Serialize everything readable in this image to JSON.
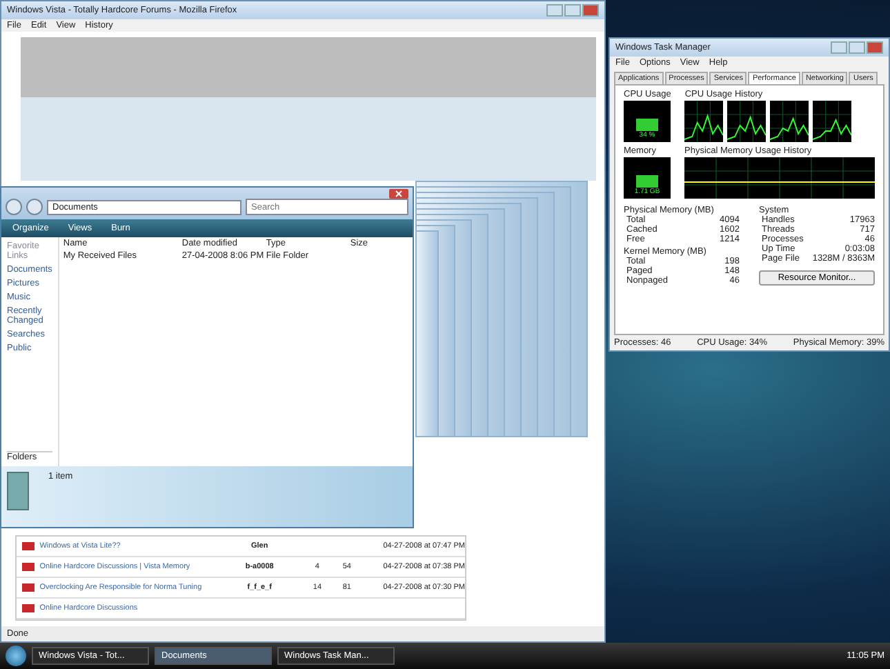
{
  "browser": {
    "title": "Windows Vista - Totally Hardcore Forums - Mozilla Firefox",
    "menu": [
      "File",
      "Edit",
      "View",
      "History"
    ],
    "status": "Done",
    "rows": [
      {
        "title": "Windows at Vista Lite??",
        "user": "Glen",
        "replies": "",
        "views": "",
        "last": "04-27-2008 at 07:47 PM"
      },
      {
        "title": "Online Hardcore Discussions | Vista Memory",
        "user": "b-a0008",
        "replies": "4",
        "views": "54",
        "last": "04-27-2008 at 07:38 PM"
      },
      {
        "title": "Overclocking Are Responsible for Norma Tuning",
        "user": "f_f_e_f",
        "replies": "14",
        "views": "81",
        "last": "04-27-2008 at 07:30 PM"
      },
      {
        "title": "Online Hardcore Discussions",
        "user": "",
        "replies": "",
        "views": "",
        "last": ""
      }
    ]
  },
  "task_manager": {
    "title": "Windows Task Manager",
    "menu": [
      "File",
      "Options",
      "View",
      "Help"
    ],
    "tabs": [
      {
        "label": "Applications",
        "selected": false
      },
      {
        "label": "Processes",
        "selected": false
      },
      {
        "label": "Services",
        "selected": false
      },
      {
        "label": "Performance",
        "selected": true
      },
      {
        "label": "Networking",
        "selected": false
      },
      {
        "label": "Users",
        "selected": false
      }
    ],
    "cpu_label": "CPU Usage",
    "cpu_value": "34 %",
    "cpu_history_label": "CPU Usage History",
    "memory_label": "Memory",
    "memory_value": "1.71 GB",
    "memory_history_label": "Physical Memory Usage History",
    "physical": {
      "heading": "Physical Memory (MB)",
      "rows": [
        {
          "label": "Total",
          "value": "4094"
        },
        {
          "label": "Cached",
          "value": "1602"
        },
        {
          "label": "Free",
          "value": "1214"
        }
      ]
    },
    "kernel": {
      "heading": "Kernel Memory (MB)",
      "rows": [
        {
          "label": "Total",
          "value": "198"
        },
        {
          "label": "Paged",
          "value": "148"
        },
        {
          "label": "Nonpaged",
          "value": "46"
        }
      ]
    },
    "system": {
      "heading": "System",
      "rows": [
        {
          "label": "Handles",
          "value": "17963"
        },
        {
          "label": "Threads",
          "value": "717"
        },
        {
          "label": "Processes",
          "value": "46"
        },
        {
          "label": "Up Time",
          "value": "0:03:08"
        },
        {
          "label": "Page File",
          "value": "1328M / 8363M"
        }
      ]
    },
    "button": "Resource Monitor...",
    "status": [
      "Processes: 46",
      "CPU Usage: 34%",
      "Physical Memory: 39%"
    ]
  },
  "explorer": {
    "path": "Documents",
    "search": {
      "placeholder": "Search"
    },
    "toolbar": [
      "Organize",
      "Views",
      "Burn"
    ],
    "links_heading": "Favorite Links",
    "links": [
      "Documents",
      "Pictures",
      "Music",
      "Recently Changed",
      "Searches",
      "Public"
    ],
    "folders": "Folders",
    "columns": [
      "Name",
      "Date modified",
      "Type",
      "Size"
    ],
    "files": [
      {
        "name": "My Received Files",
        "date": "27-04-2008 8:06 PM",
        "type": "File Folder"
      }
    ],
    "status": "1 item"
  },
  "taskbar": {
    "items": [
      {
        "label": "Windows Vista - Tot...",
        "selected": false
      },
      {
        "label": "Documents",
        "selected": true
      },
      {
        "label": "Windows Task Man...",
        "selected": false
      }
    ],
    "clock": "11:05 PM"
  }
}
